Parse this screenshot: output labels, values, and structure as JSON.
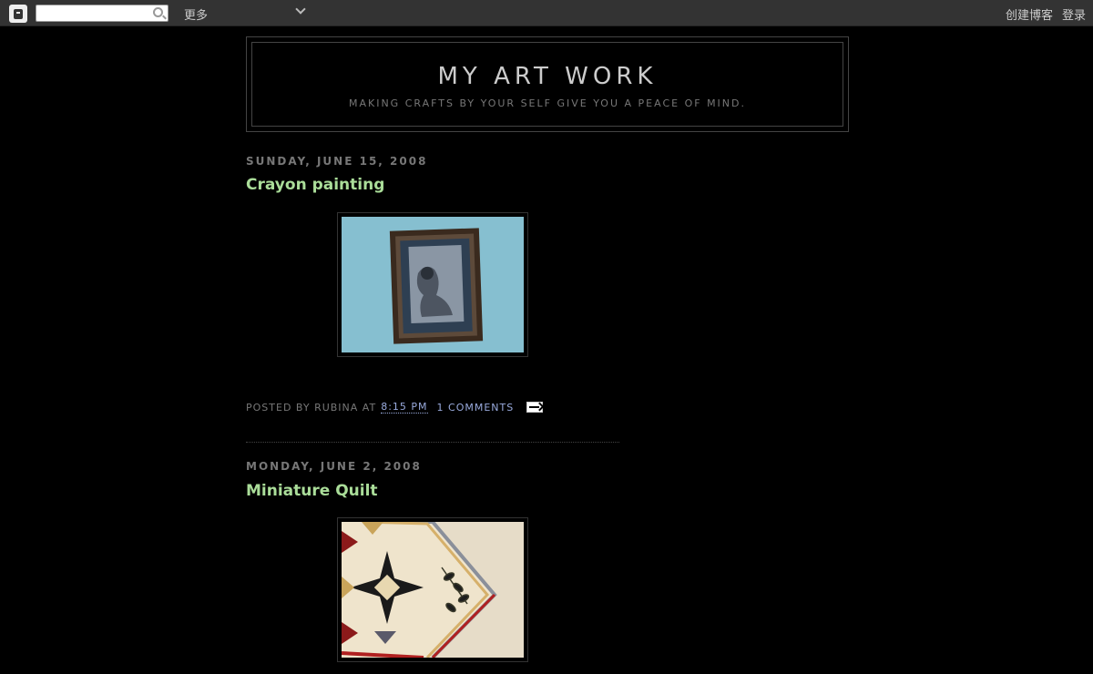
{
  "navbar": {
    "search_placeholder": "",
    "more_label": "更多",
    "create_blog": "创建博客",
    "login": "登录"
  },
  "header": {
    "title": "MY ART WORK",
    "description": "MAKING CRAFTS BY YOUR SELF GIVE YOU A PEACE OF MIND."
  },
  "posts": [
    {
      "date": "SUNDAY, JUNE 15, 2008",
      "title": "Crayon painting",
      "footer": {
        "posted_by": "POSTED BY RUBINA AT",
        "time": "8:15 PM",
        "comments": "1 COMMENTS"
      }
    },
    {
      "date": "MONDAY, JUNE 2, 2008",
      "title": "Miniature Quilt"
    }
  ],
  "colors": {
    "background": "#000000",
    "post_title": "#aadd99",
    "link": "#99aadd",
    "muted": "#777777"
  }
}
